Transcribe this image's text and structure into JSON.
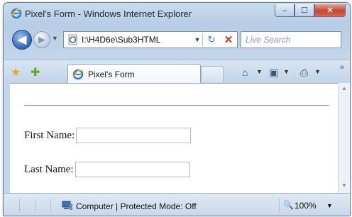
{
  "window": {
    "title": "Pixel's Form - Windows Internet Explorer"
  },
  "caption_buttons": {
    "minimize": "–",
    "maximize": "☐",
    "close": "✕"
  },
  "nav": {
    "back_glyph": "◀",
    "forward_glyph": "▶",
    "address": "I:\\H4D6e\\Sub3HTML",
    "refresh_glyph": "↻",
    "stop_glyph": "✕",
    "search_placeholder": "Live Search"
  },
  "tab": {
    "label": "Pixel's Form"
  },
  "toolbar": {
    "favorites_icon": "star-icon",
    "add_favorites_icon": "add-favorites-icon",
    "home_icon": "home-icon",
    "feeds_icon": "feeds-icon",
    "print_icon": "print-icon",
    "chevron": "»"
  },
  "form": {
    "fields": [
      {
        "label": "First Name:",
        "value": ""
      },
      {
        "label": "Last Name:",
        "value": ""
      }
    ]
  },
  "status": {
    "zone": "Computer | Protected Mode: Off",
    "zoom": "100%"
  },
  "colors": {
    "rule": "#b27c76",
    "close_button": "#c4452d",
    "frame": "#b7cde5"
  }
}
